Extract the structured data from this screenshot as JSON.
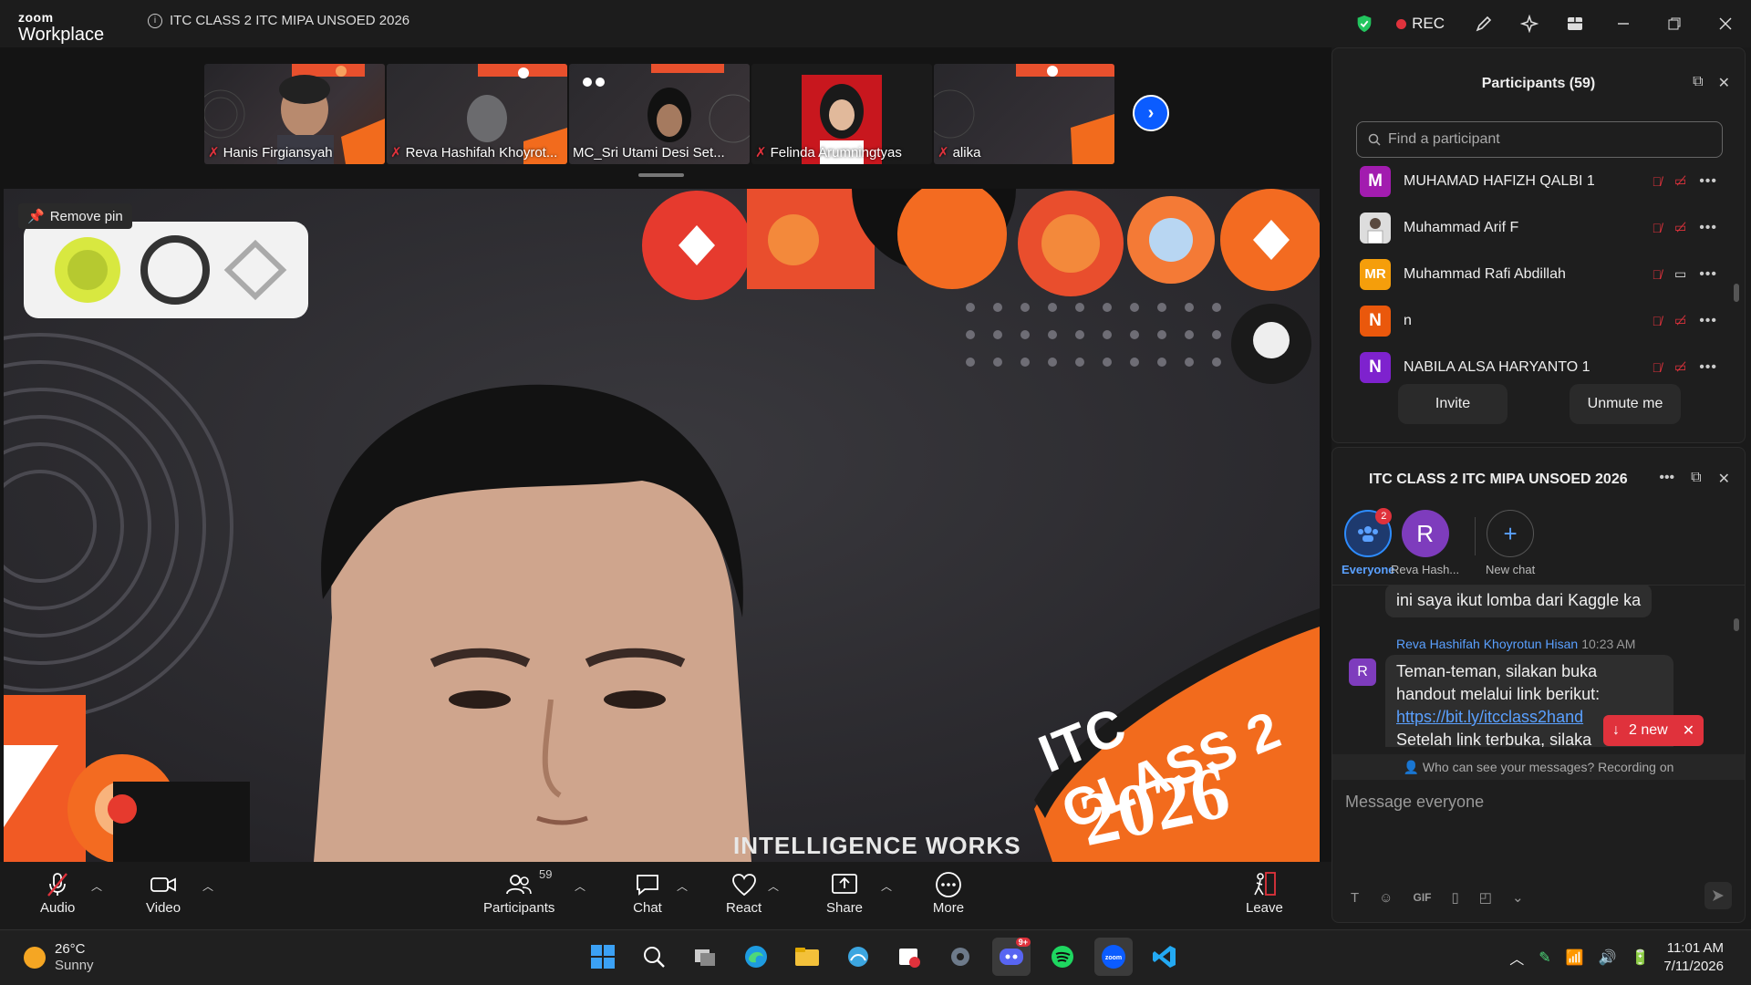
{
  "app": {
    "brand_top": "zoom",
    "brand_bottom": "Workplace",
    "meeting_title": "ITC CLASS 2 ITC MIPA UNSOED 2026",
    "rec_label": "REC"
  },
  "thumbnails": [
    {
      "name": "Hanis Firgiansyah"
    },
    {
      "name": "Reva Hashifah Khoyrot..."
    },
    {
      "name": "MC_Sri Utami Desi Set..."
    },
    {
      "name": "Felinda Arumningtyas"
    },
    {
      "name": "alika"
    }
  ],
  "main_video": {
    "pin_label": "Remove pin",
    "banner_line1": "ITC CLASS 2",
    "banner_line2": "2026",
    "caption": "INTELLIGENCE WORKS"
  },
  "toolbar": {
    "audio": "Audio",
    "video": "Video",
    "participants": "Participants",
    "participants_count": "59",
    "chat": "Chat",
    "react": "React",
    "share": "Share",
    "more": "More",
    "leave": "Leave"
  },
  "participants_panel": {
    "title": "Participants (59)",
    "search_placeholder": "Find a participant",
    "rows": [
      {
        "initials": "M",
        "name": "MUHAMAD HAFIZH QALBI 1",
        "color": "#a21caf"
      },
      {
        "initials": "",
        "name": "Muhammad Arif F",
        "color": "#dddddd"
      },
      {
        "initials": "MR",
        "name": "Muhammad Rafi Abdillah",
        "color": "#f59e0b"
      },
      {
        "initials": "N",
        "name": "n",
        "color": "#ea580c"
      },
      {
        "initials": "N",
        "name": "NABILA ALSA HARYANTO 1",
        "color": "#7e22ce"
      }
    ],
    "invite": "Invite",
    "unmute": "Unmute me"
  },
  "chat_panel": {
    "title": "ITC CLASS 2 ITC MIPA UNSOED 2026",
    "channels": [
      {
        "label": "Everyone",
        "badge": "2"
      },
      {
        "label": "Reva Hash...",
        "initial": "R"
      },
      {
        "label": "New chat"
      }
    ],
    "msg1": "ini saya ikut lomba dari Kaggle ka",
    "sender": "Reva Hashifah Khoyrotun Hisan",
    "time": "10:23 AM",
    "sender_initial": "R",
    "msg2_line1": "Teman-teman, silakan buka",
    "msg2_line2": "handout melalui link berikut:",
    "msg2_link": "https://bit.ly/itcclass2hand",
    "msg2_line4": "Setelah link terbuka, silaka",
    "new_pill": "2 new",
    "who_can_see": "Who can see your messages? Recording on",
    "input_placeholder": "Message everyone",
    "gif": "GIF"
  },
  "taskbar": {
    "temp": "26°C",
    "weather": "Sunny",
    "time": "11:01 AM",
    "date": "7/11/2026",
    "discord_badge": "9+"
  },
  "colors": {
    "accent": "#0b5cff",
    "mute_red": "#e0323c",
    "banner_orange": "#f26b1d"
  }
}
